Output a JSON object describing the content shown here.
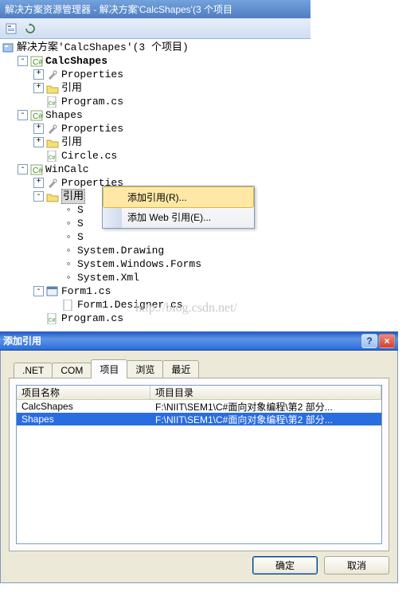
{
  "solution_explorer": {
    "title": "解决方案资源管理器 - 解决方案'CalcShapes'(3 个项目",
    "root_label": "解决方案'CalcShapes'(3 个项目)",
    "projects": {
      "calcshapes": {
        "name": "CalcShapes",
        "properties": "Properties",
        "references": "引用",
        "file1": "Program.cs"
      },
      "shapes": {
        "name": "Shapes",
        "properties": "Properties",
        "references": "引用",
        "file1": "Circle.cs"
      },
      "wincalc": {
        "name": "WinCalc",
        "properties": "Properties",
        "references": "引用",
        "ref_items": {
          "r1": "S",
          "r2": "S",
          "r3": "S",
          "r4": "System.Drawing",
          "r5": "System.Windows.Forms",
          "r6": "System.Xml"
        },
        "form1": "Form1.cs",
        "form1_designer": "Form1.Designer.cs",
        "program": "Program.cs"
      }
    }
  },
  "context_menu": {
    "add_reference": "添加引用(R)...",
    "add_web_reference": "添加 Web 引用(E)..."
  },
  "watermark": "http://blog.csdn.net/",
  "dialog": {
    "title": "添加引用",
    "tabs": {
      "net": ".NET",
      "com": "COM",
      "project": "项目",
      "browse": "浏览",
      "recent": "最近"
    },
    "columns": {
      "name": "项目名称",
      "dir": "项目目录"
    },
    "rows": [
      {
        "name": "CalcShapes",
        "dir": "F:\\NIIT\\SEM1\\C#面向对象编程\\第2 部分..."
      },
      {
        "name": "Shapes",
        "dir": "F:\\NIIT\\SEM1\\C#面向对象编程\\第2 部分..."
      }
    ],
    "ok": "确定",
    "cancel": "取消"
  }
}
